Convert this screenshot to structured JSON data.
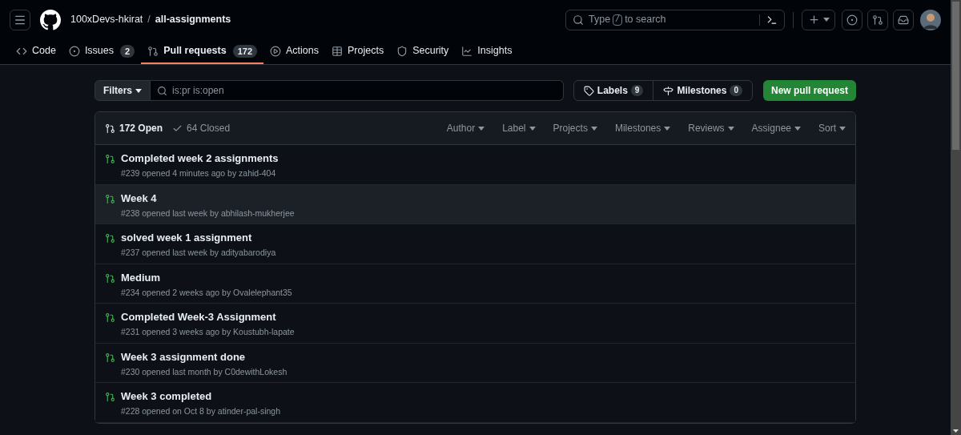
{
  "header": {
    "owner": "100xDevs-hkirat",
    "separator": "/",
    "repo": "all-assignments",
    "search": {
      "before": "Type",
      "key": "/",
      "after": "to search"
    }
  },
  "tabs": [
    {
      "label": "Code",
      "selected": false
    },
    {
      "label": "Issues",
      "count": "2",
      "selected": false
    },
    {
      "label": "Pull requests",
      "count": "172",
      "selected": true
    },
    {
      "label": "Actions",
      "selected": false
    },
    {
      "label": "Projects",
      "selected": false
    },
    {
      "label": "Security",
      "selected": false
    },
    {
      "label": "Insights",
      "selected": false
    }
  ],
  "toolbar": {
    "filters": "Filters",
    "query": "is:pr is:open",
    "labels": {
      "label": "Labels",
      "count": "9"
    },
    "milestones": {
      "label": "Milestones",
      "count": "0"
    },
    "new_button": "New pull request"
  },
  "list_header": {
    "states": [
      {
        "label": "172 Open",
        "selected": true
      },
      {
        "label": "64 Closed",
        "selected": false
      }
    ],
    "filters": [
      "Author",
      "Label",
      "Projects",
      "Milestones",
      "Reviews",
      "Assignee",
      "Sort"
    ]
  },
  "pull_requests": [
    {
      "title": "Completed week 2 assignments",
      "meta": "#239 opened 4 minutes ago by zahid-404",
      "highlighted": false
    },
    {
      "title": "Week 4",
      "meta": "#238 opened last week by abhilash-mukherjee",
      "highlighted": true
    },
    {
      "title": "solved week 1 assignment",
      "meta": "#237 opened last week by adityabarodiya",
      "highlighted": false
    },
    {
      "title": "Medium",
      "meta": "#234 opened 2 weeks ago by Ovalelephant35",
      "highlighted": false
    },
    {
      "title": "Completed Week-3 Assignment",
      "meta": "#231 opened 3 weeks ago by Koustubh-lapate",
      "highlighted": false
    },
    {
      "title": "Week 3 assignment done",
      "meta": "#230 opened last month by C0dewithLokesh",
      "highlighted": false
    },
    {
      "title": "Week 3 completed",
      "meta": "#228 opened on Oct 8 by atinder-pal-singh",
      "highlighted": false
    }
  ]
}
